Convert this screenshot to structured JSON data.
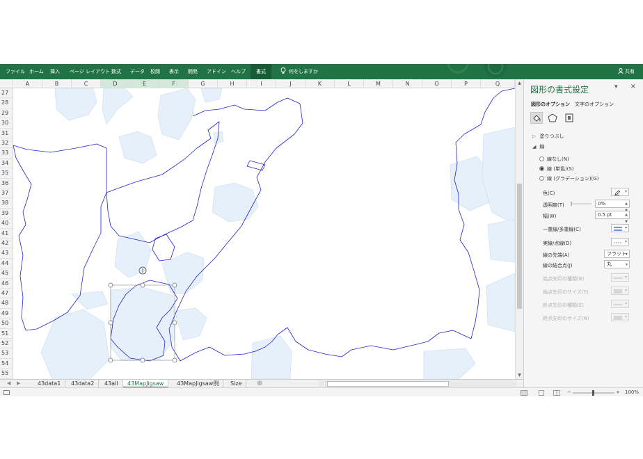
{
  "ribbon": {
    "tabs": [
      "ファイル",
      "ホーム",
      "挿入",
      "ページ レイアウト",
      "数式",
      "データ",
      "校閲",
      "表示",
      "開発",
      "アドイン",
      "ヘルプ"
    ],
    "active_tab": "書式",
    "tell_me": "何をしますか",
    "share": "共有",
    "color": "#217346"
  },
  "columns": [
    "A",
    "B",
    "C",
    "D",
    "E",
    "F",
    "G",
    "H",
    "I",
    "J",
    "K",
    "L",
    "M",
    "N",
    "O",
    "P",
    "Q"
  ],
  "rows": [
    "27",
    "28",
    "29",
    "30",
    "31",
    "32",
    "33",
    "34",
    "35",
    "36",
    "37",
    "38",
    "39",
    "40",
    "41",
    "42",
    "43",
    "44",
    "45",
    "46",
    "47",
    "48",
    "49",
    "50",
    "51",
    "52",
    "53",
    "54",
    "55"
  ],
  "sheets": [
    "43data1",
    "43data2",
    "43all",
    "43MapJigsaw",
    "43MapJigsaw例",
    "Size"
  ],
  "active_sheet": "43MapJigsaw",
  "status": {
    "zoom": "100%"
  },
  "pane": {
    "title": "図形の書式設定",
    "tabs": [
      "図形のオプション",
      "文字のオプション"
    ],
    "sections": {
      "fill": "塗りつぶし",
      "line": "線"
    },
    "line_options": [
      "線なし(N)",
      "線 (単色)(S)",
      "線 (グラデーション)(G)"
    ],
    "selected_line_option": 1,
    "props": {
      "color": "色(C)",
      "transparency": "透明度(T)",
      "transparency_value": "0%",
      "width": "幅(W)",
      "width_value": "0.5 pt",
      "compound": "一重線/多重線(C)",
      "dash": "実線/点線(D)",
      "cap": "線の先端(A)",
      "cap_value": "フラット",
      "join": "線の結合点(J)",
      "join_value": "丸",
      "begin_arrow_type": "始点矢印の種類(B)",
      "begin_arrow_size": "始点矢印のサイズ(S)",
      "end_arrow_type": "終点矢印の種類(E)",
      "end_arrow_size": "終点矢印のサイズ(N)"
    },
    "line_color": "#4472c4"
  },
  "map": {
    "outline_color": "#2222cc",
    "region_fill": "#e6f0fa"
  }
}
